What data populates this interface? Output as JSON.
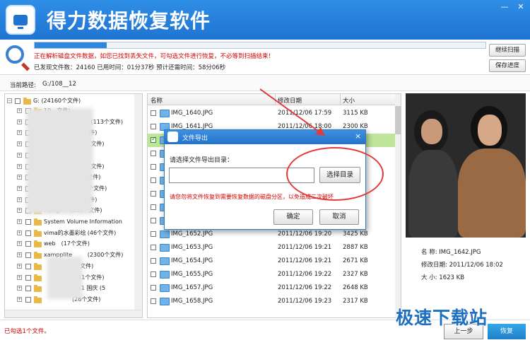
{
  "app": {
    "title": "得力数据恢复软件"
  },
  "window": {
    "minimize": "—",
    "close": "✕"
  },
  "scan": {
    "progress": 0.16,
    "status": "正在解析磁盘文件数据，如您已找到丢失文件，可勾选文件进行恢复，不必等到扫描结束！",
    "stats": "已发现文件数：24160   已用时间：01分37秒   预计还需时间：58分06秒",
    "continue_label": "继续扫描",
    "save_label": "保存进度"
  },
  "path": {
    "label": "当前路径:",
    "value": "G:/108__12"
  },
  "tree": {
    "root": "G:  (24160个文件)",
    "items": [
      {
        "label": "10",
        "count": "文件)"
      },
      {
        "label": "",
        "count": "中山陵  (113个文件)"
      },
      {
        "label": "",
        "count": "(5个文件)"
      },
      {
        "label": "",
        "count": "(231个文件)"
      },
      {
        "label": "",
        "count": "(242"
      },
      {
        "label": "",
        "count": "(113个文件)"
      },
      {
        "label": "",
        "count": "(88个文件)"
      },
      {
        "label": "",
        "count": "ter  (1个文件)"
      },
      {
        "label": "",
        "count": "(1个文件)"
      },
      {
        "label": "PCMgr",
        "count": "(236个文件)"
      },
      {
        "label": "System Volume Information",
        "count": "(1"
      },
      {
        "label": "vima的水墨彩绘",
        "count": "(46个文件)"
      },
      {
        "label": "web",
        "count": "(17个文件)"
      },
      {
        "label": "xampplite",
        "count": "(2300个文件)"
      },
      {
        "label": "",
        "count": "(个文件)"
      },
      {
        "label": "",
        "count": "(111个文件)"
      },
      {
        "label": "",
        "count": ".011 国庆  (5"
      },
      {
        "label": "",
        "count": "(26个文件)"
      }
    ]
  },
  "filelist": {
    "headers": {
      "name": "名称",
      "date": "修改日期",
      "size": "大小"
    },
    "rows": [
      {
        "name": "IMG_1640.JPG",
        "date": "2011/12/06 17:59",
        "size": "3115 KB",
        "checked": false
      },
      {
        "name": "IMG_1641.JPG",
        "date": "2011/12/06 18:00",
        "size": "2300 KB",
        "checked": false
      },
      {
        "name": "",
        "date": "",
        "size": "",
        "checked": true
      },
      {
        "name": "",
        "date": "",
        "size": "",
        "checked": false
      },
      {
        "name": "",
        "date": "",
        "size": "",
        "checked": false
      },
      {
        "name": "",
        "date": "",
        "size": "",
        "checked": false
      },
      {
        "name": "",
        "date": "",
        "size": "",
        "checked": false
      },
      {
        "name": "",
        "date": "",
        "size": "",
        "checked": false
      },
      {
        "name": "",
        "date": "",
        "size": "",
        "checked": false
      },
      {
        "name": "IMG_1652.JPG",
        "date": "2011/12/06 19:20",
        "size": "3425 KB",
        "checked": false
      },
      {
        "name": "IMG_1653.JPG",
        "date": "2011/12/06 19:21",
        "size": "2887 KB",
        "checked": false
      },
      {
        "name": "IMG_1654.JPG",
        "date": "2011/12/06 19:21",
        "size": "2671 KB",
        "checked": false
      },
      {
        "name": "IMG_1655.JPG",
        "date": "2011/12/06 19:22",
        "size": "2327 KB",
        "checked": false
      },
      {
        "name": "IMG_1657.JPG",
        "date": "2011/12/06 19:22",
        "size": "2648 KB",
        "checked": false
      },
      {
        "name": "IMG_1658.JPG",
        "date": "2011/12/06 19:23",
        "size": "2317 KB",
        "checked": false
      }
    ]
  },
  "preview": {
    "name_label": "名    称:",
    "name_value": "IMG_1642.JPG",
    "date_label": "修改日期:",
    "date_value": "2011/12/06 18:02",
    "size_label": "大    小:",
    "size_value": "1623 KB"
  },
  "dialog": {
    "title": "文件导出",
    "close": "×",
    "prompt": "请选择文件导出目录：",
    "input_value": "",
    "browse_label": "选择目录",
    "warning": "请您勿将文件恢复到需要恢复数据的磁盘分区，以免造成二次破坏",
    "ok_label": "确定",
    "cancel_label": "取消"
  },
  "footer": {
    "status": "已勾选1个文件。",
    "prev_label": "上一步",
    "recover_label": "恢复"
  },
  "watermark": "极速下载站",
  "colors": {
    "accent": "#1f74d2",
    "warning": "#d40000",
    "annotation": "#e23b3b"
  }
}
